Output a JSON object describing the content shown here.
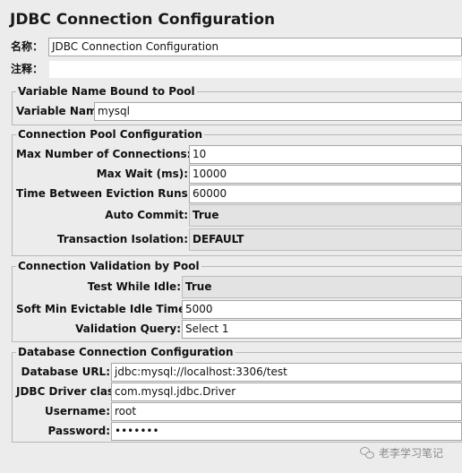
{
  "title": "JDBC Connection Configuration",
  "top": {
    "name_label": "名称：",
    "name_value": "JDBC Connection Configuration",
    "comment_label": "注释：",
    "comment_value": ""
  },
  "variable_group": {
    "legend": "Variable Name Bound to Pool",
    "variable_name_label": "Variable Name:",
    "variable_name_value": "mysql"
  },
  "pool_group": {
    "legend": "Connection Pool Configuration",
    "max_connections_label": "Max Number of Connections:",
    "max_connections_value": "10",
    "max_wait_label": "Max Wait (ms):",
    "max_wait_value": "10000",
    "eviction_label": "Time Between Eviction Runs (ms):",
    "eviction_value": "60000",
    "auto_commit_label": "Auto Commit:",
    "auto_commit_value": "True",
    "isolation_label": "Transaction Isolation:",
    "isolation_value": "DEFAULT"
  },
  "validation_group": {
    "legend": "Connection Validation by Pool",
    "test_idle_label": "Test While Idle:",
    "test_idle_value": "True",
    "soft_min_label": "Soft Min Evictable Idle Time(ms):",
    "soft_min_value": "5000",
    "validation_query_label": "Validation Query:",
    "validation_query_value": "Select 1"
  },
  "db_group": {
    "legend": "Database Connection Configuration",
    "url_label": "Database URL:",
    "url_value": "jdbc:mysql://localhost:3306/test",
    "driver_label": "JDBC Driver class:",
    "driver_value": "com.mysql.jdbc.Driver",
    "username_label": "Username:",
    "username_value": "root",
    "password_label": "Password:",
    "password_value": "•••••••"
  },
  "watermark": {
    "icon": "wechat-icon",
    "text": "老李学习笔记"
  }
}
